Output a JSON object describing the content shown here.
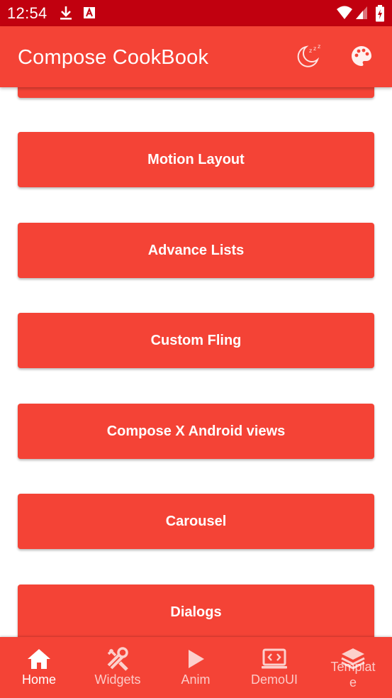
{
  "status_bar": {
    "time": "12:54",
    "icons": [
      "download-icon",
      "a-badge-icon",
      "wifi-icon",
      "signal-icon",
      "battery-icon"
    ]
  },
  "app_bar": {
    "title": "Compose CookBook",
    "actions": [
      "sleep-moon-icon",
      "palette-icon"
    ]
  },
  "list": {
    "items": [
      {
        "label": ""
      },
      {
        "label": "Motion Layout"
      },
      {
        "label": "Advance Lists"
      },
      {
        "label": "Custom Fling"
      },
      {
        "label": "Compose X Android views"
      },
      {
        "label": "Carousel"
      },
      {
        "label": "Dialogs"
      }
    ]
  },
  "bottom_nav": {
    "items": [
      {
        "label": "Home",
        "icon": "home-icon",
        "active": true
      },
      {
        "label": "Widgets",
        "icon": "tools-icon",
        "active": false
      },
      {
        "label": "Anim",
        "icon": "play-icon",
        "active": false
      },
      {
        "label": "DemoUI",
        "icon": "code-monitor-icon",
        "active": false
      },
      {
        "label": "Template",
        "icon": "layers-icon",
        "active": false
      }
    ]
  },
  "colors": {
    "primary": "#f44336",
    "status_bar": "#c1000f",
    "on_primary": "#ffffff",
    "background": "#ffffff"
  }
}
